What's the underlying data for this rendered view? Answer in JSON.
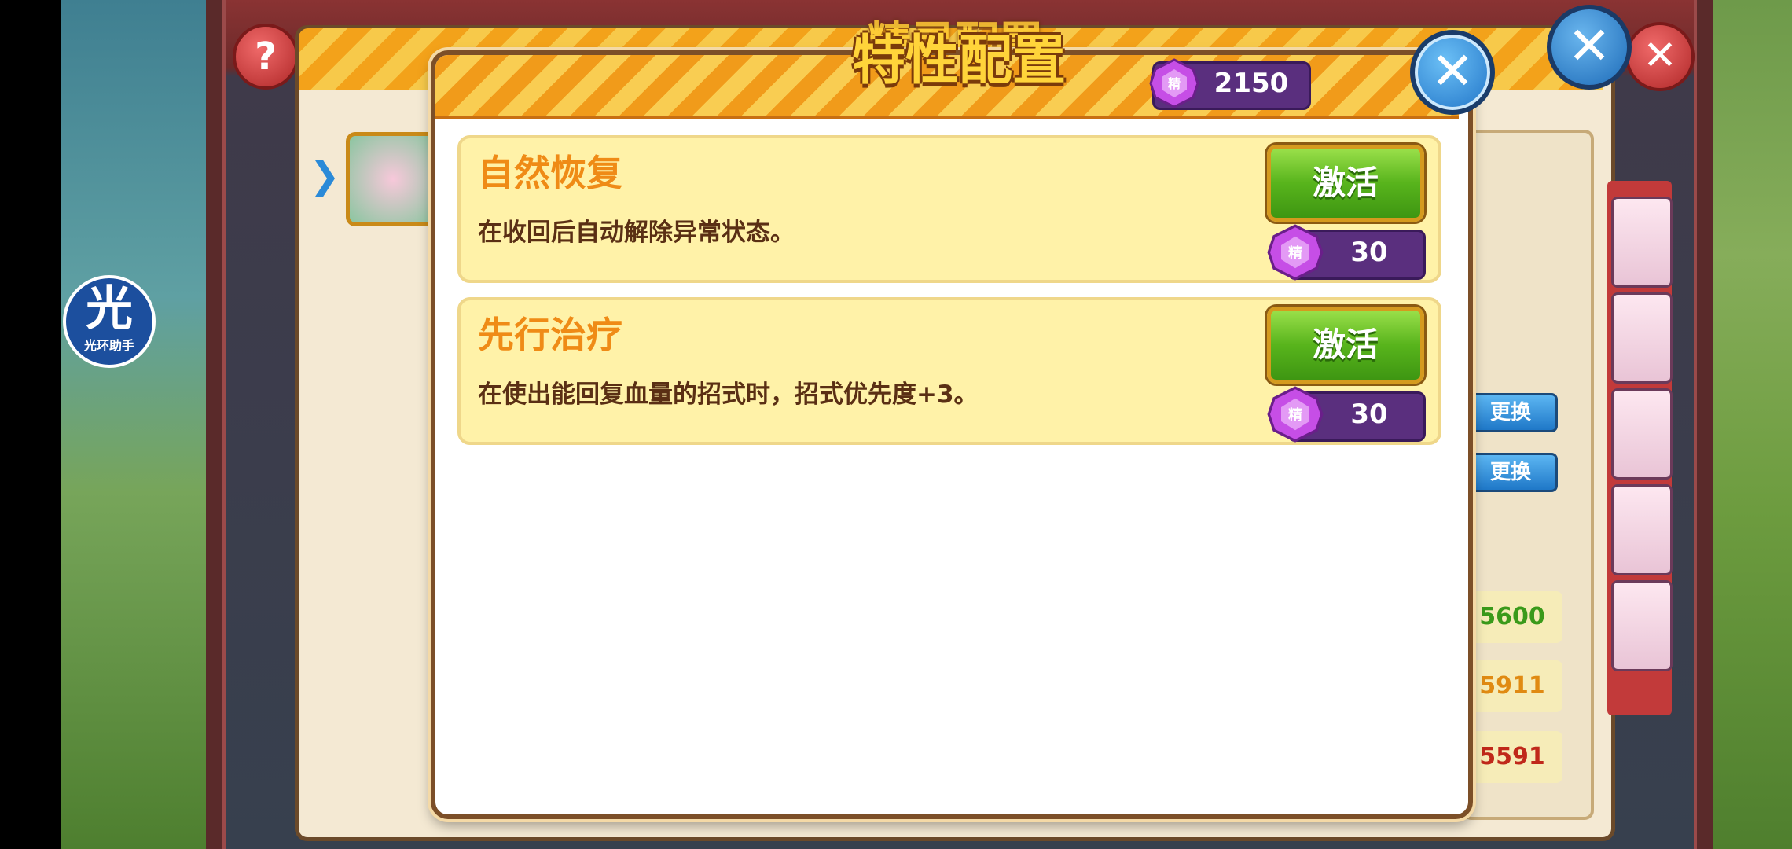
{
  "modal": {
    "title": "特性配置",
    "currency": {
      "icon": "purple-gem-icon",
      "gem_label": "精",
      "amount": "2150"
    },
    "close_icon": "✕",
    "traits": [
      {
        "name": "自然恢复",
        "description": "在收回后自动解除异常状态。",
        "button_label": "激活",
        "cost": "30",
        "cost_gem_label": "精"
      },
      {
        "name": "先行治疗",
        "description": "在使出能回复血量的招式时，招式优先度+3。",
        "button_label": "激活",
        "cost": "30",
        "cost_gem_label": "精"
      }
    ]
  },
  "background": {
    "title": "精灵配置",
    "help_label": "?",
    "close_label": "✕",
    "swap_buttons": [
      "更换",
      "更换"
    ],
    "stats": [
      {
        "value": "5600",
        "color": "#3a9a1a"
      },
      {
        "value": "5911",
        "color": "#e08a12"
      },
      {
        "value": "5591",
        "color": "#c0281a"
      }
    ]
  },
  "app_badge": {
    "char": "光",
    "label": "光环助手"
  },
  "colors": {
    "trait_name": "#ef8b16",
    "trait_card_bg": "#fff2a8",
    "activate_green": "#58b41c",
    "gem_purple": "#a93ad0",
    "cost_bg": "#5a2f7e"
  }
}
